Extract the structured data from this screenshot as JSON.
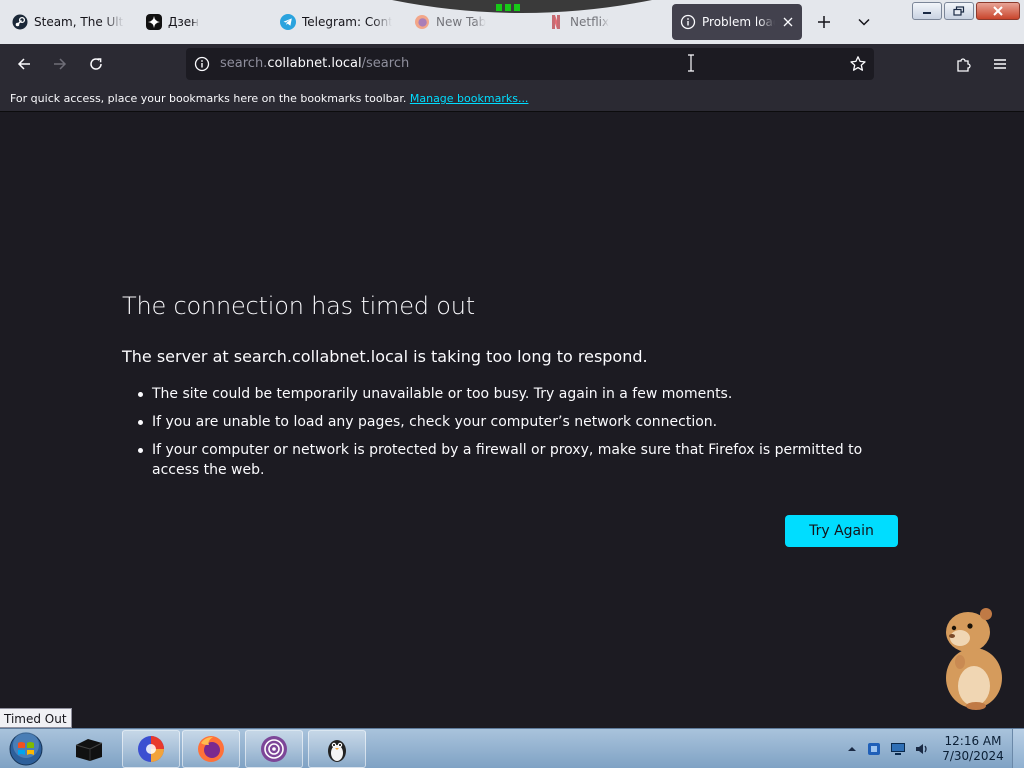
{
  "browser": {
    "tabs": [
      {
        "label": "Steam, The Ultim",
        "icon": "steam-icon"
      },
      {
        "label": "Дзен",
        "icon": "dzen-icon"
      },
      {
        "label": "Telegram: Conta",
        "icon": "telegram-icon"
      },
      {
        "label": "New Tab",
        "icon": "firefox-icon"
      },
      {
        "label": "Netflix",
        "icon": "netflix-icon"
      },
      {
        "label": "Problem loadi",
        "icon": "info-icon",
        "active": true
      }
    ],
    "url": {
      "prefix": "search.",
      "host": "collabnet.local",
      "path": "/search"
    },
    "bookmarks_bar": {
      "message": "For quick access, place your bookmarks here on the bookmarks toolbar. ",
      "link": "Manage bookmarks..."
    },
    "accent_color": "#00ddff"
  },
  "error_page": {
    "title": "The connection has timed out",
    "subtitle": "The server at search.collabnet.local is taking too long to respond.",
    "bullets": [
      "The site could be temporarily unavailable or too busy. Try again in a few moments.",
      "If you are unable to load any pages, check your computer’s network connection.",
      "If your computer or network is protected by a firewall or proxy, make sure that Firefox is permitted to access the web."
    ],
    "try_again_label": "Try Again"
  },
  "status_tooltip": "Timed Out",
  "taskbar": {
    "items": [
      "start-orb-icon",
      "black-box-icon",
      "browser-swirl-icon",
      "firefox-icon",
      "tor-browser-icon",
      "penguin-app-icon"
    ],
    "clock": {
      "time": "12:16 AM",
      "date": "7/30/2024"
    }
  }
}
